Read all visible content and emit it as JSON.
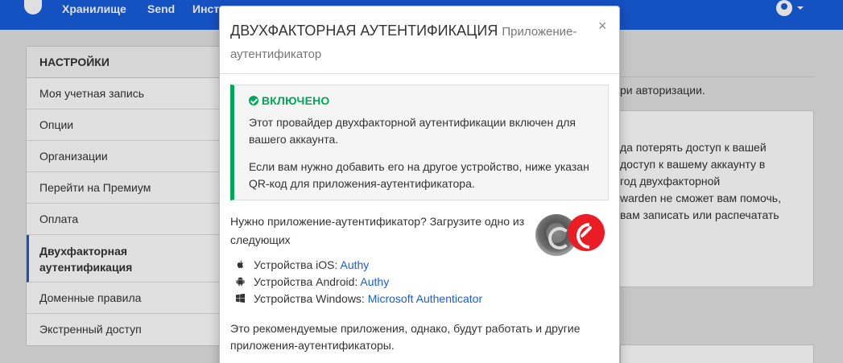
{
  "navbar": {
    "links": [
      "Хранилище",
      "Send",
      "Инст"
    ]
  },
  "sidebar": {
    "heading": "НАСТРОЙКИ",
    "items": [
      {
        "label": "Моя учетная запись"
      },
      {
        "label": "Опции"
      },
      {
        "label": "Организации"
      },
      {
        "label": "Перейти на Премиум"
      },
      {
        "label": "Оплата"
      },
      {
        "label": "Двухфакторная аутентификация",
        "active": true
      },
      {
        "label": "Доменные правила"
      },
      {
        "label": "Экстренный доступ"
      }
    ]
  },
  "background": {
    "intro_text": "ри авторизации.",
    "warning_lines": [
      "да потерять доступ к вашей",
      "доступ к вашему аккаунту в",
      "год двухфакторной",
      "warden не сможет вам помочь,",
      "вам записать или распечатать"
    ]
  },
  "modal": {
    "title": "ДВУХФАКТОРНАЯ АУТЕНТИФИКАЦИЯ",
    "subtitle": "Приложение-аутентификатор",
    "close_label": "×",
    "status": {
      "title": "ВКЛЮЧЕНО",
      "color": "#00a65a",
      "paragraph1": "Этот провайдер двухфакторной аутентификации включен для вашего аккаунта.",
      "paragraph2": "Если вам нужно добавить его на другое устройство, ниже указан QR-код для приложения-аутентификатора."
    },
    "need_app_text": "Нужно приложение-аутентификатор? Загрузите одно из следующих",
    "apps": [
      {
        "icon": "apple-icon",
        "prefix": "Устройства iOS:",
        "link": "Authy"
      },
      {
        "icon": "android-icon",
        "prefix": "Устройства Android:",
        "link": "Authy"
      },
      {
        "icon": "windows-icon",
        "prefix": "Устройства Windows:",
        "link": "Microsoft Authenticator"
      }
    ],
    "recommend_text": "Это рекомендуемые приложения, однако, будут работать и другие приложения-аутентификаторы."
  },
  "colors": {
    "brand": "#175ddc",
    "link": "#175ddc",
    "success": "#00a65a"
  }
}
